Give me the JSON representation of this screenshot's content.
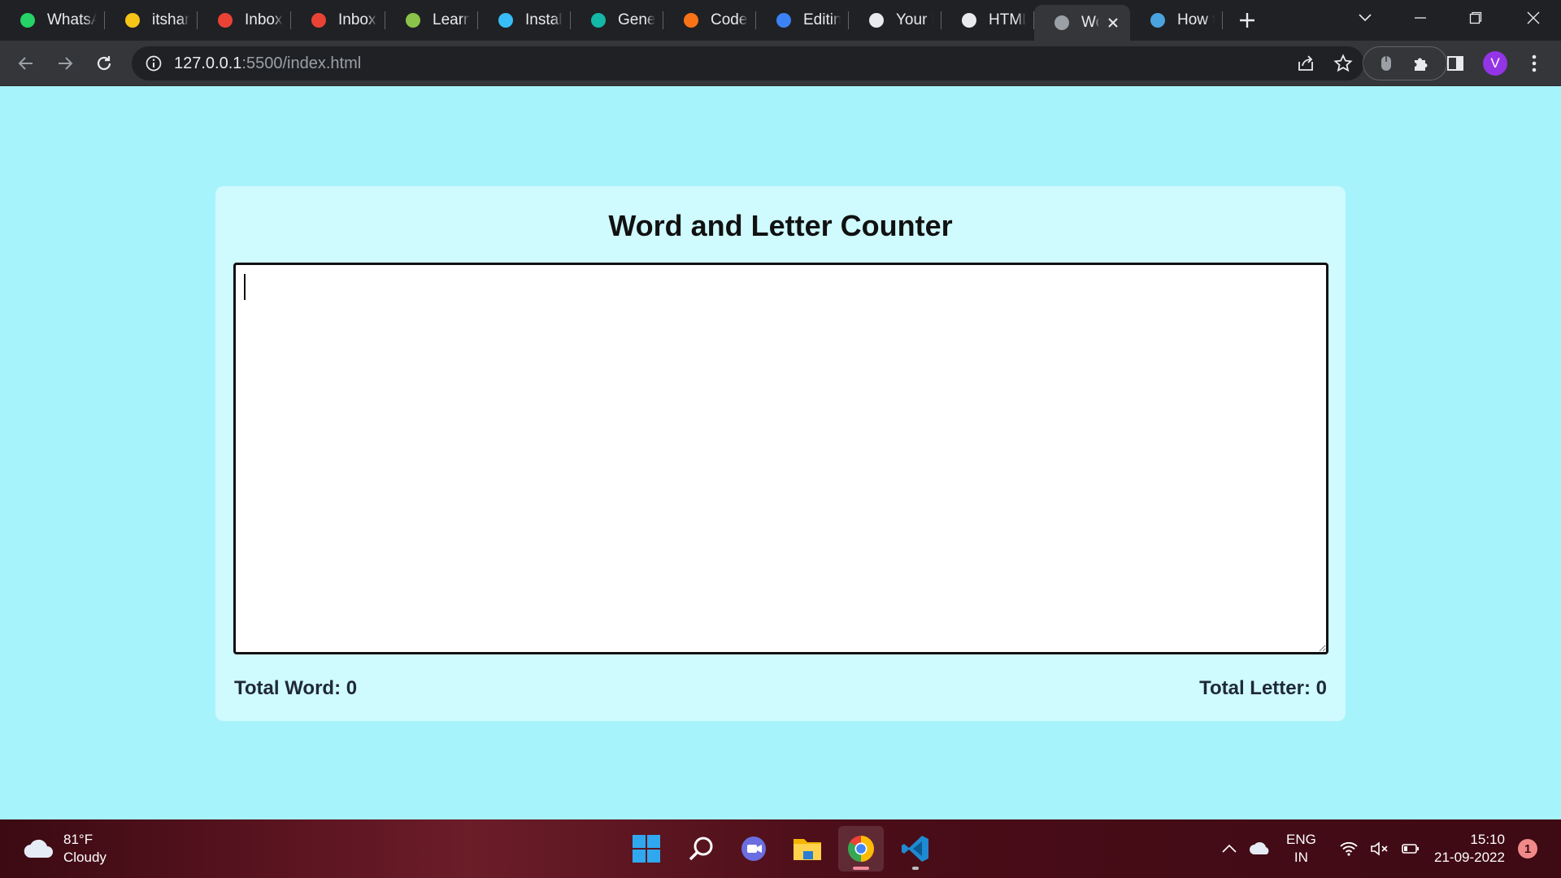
{
  "browser": {
    "tabs": [
      {
        "title": "WhatsApp",
        "icon": "whatsapp-icon",
        "color": "#25d366"
      },
      {
        "title": "itsharvi",
        "icon": "bolt-icon",
        "color": "#f5c518"
      },
      {
        "title": "Inbox -",
        "icon": "gmail-icon",
        "color": "#ea4335"
      },
      {
        "title": "Inbox (",
        "icon": "gmail-icon",
        "color": "#ea4335"
      },
      {
        "title": "Learn c",
        "icon": "code-play-icon",
        "color": "#8bc34a"
      },
      {
        "title": "Installa",
        "icon": "tailwind-icon",
        "color": "#38bdf8"
      },
      {
        "title": "Genera",
        "icon": "diamond-icon",
        "color": "#14b8a6"
      },
      {
        "title": "Coder",
        "icon": "braces-icon",
        "color": "#f97316"
      },
      {
        "title": "Editing",
        "icon": "editor-icon",
        "color": "#3b82f6"
      },
      {
        "title": "Your R",
        "icon": "github-icon",
        "color": "#e8eaed"
      },
      {
        "title": "HTMLE",
        "icon": "m-logo-icon",
        "color": "#e8eaed"
      },
      {
        "title": "Wo",
        "icon": "globe-icon",
        "color": "#9aa0a6",
        "active": true
      },
      {
        "title": "How to",
        "icon": "edge-icon",
        "color": "#4aa3df"
      }
    ],
    "url_host": "127.0.0.1",
    "url_rest": ":5500/index.html",
    "avatar_letter": "V"
  },
  "page": {
    "title": "Word and Letter Counter",
    "textarea_value": "",
    "word_label": "Total Word: ",
    "word_count": "0",
    "letter_label": "Total Letter: ",
    "letter_count": "0"
  },
  "taskbar": {
    "weather_temp": "81°F",
    "weather_desc": "Cloudy",
    "lang_top": "ENG",
    "lang_bottom": "IN",
    "time": "15:10",
    "date": "21-09-2022",
    "notification_count": "1"
  }
}
